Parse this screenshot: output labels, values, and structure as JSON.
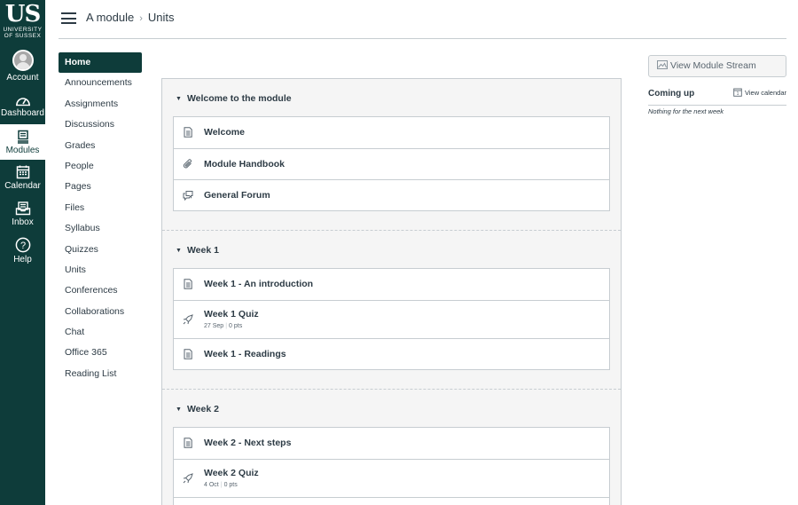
{
  "global_nav": {
    "logo_main": "US",
    "logo_line1": "UNIVERSITY",
    "logo_line2": "OF SUSSEX",
    "items": [
      {
        "label": "Account",
        "icon": "avatar-icon"
      },
      {
        "label": "Dashboard",
        "icon": "dashboard-icon"
      },
      {
        "label": "Modules",
        "icon": "modules-icon",
        "active": true
      },
      {
        "label": "Calendar",
        "icon": "calendar-icon"
      },
      {
        "label": "Inbox",
        "icon": "inbox-icon"
      },
      {
        "label": "Help",
        "icon": "help-icon"
      }
    ],
    "colors": {
      "background": "#0e3c3a",
      "text": "#ffffff"
    }
  },
  "header": {
    "breadcrumb": [
      "A module",
      "Units"
    ],
    "breadcrumb_separator": "›"
  },
  "course_nav": {
    "items": [
      "Home",
      "Announcements",
      "Assignments",
      "Discussions",
      "Grades",
      "People",
      "Pages",
      "Files",
      "Syllabus",
      "Quizzes",
      "Units",
      "Conferences",
      "Collaborations",
      "Chat",
      "Office 365",
      "Reading List"
    ],
    "active": "Home"
  },
  "modules": [
    {
      "title": "Welcome to the module",
      "items": [
        {
          "title": "Welcome",
          "icon": "page-icon"
        },
        {
          "title": "Module Handbook",
          "icon": "attachment-icon"
        },
        {
          "title": "General Forum",
          "icon": "discussion-icon"
        }
      ]
    },
    {
      "title": "Week 1",
      "items": [
        {
          "title": "Week 1 - An introduction",
          "icon": "page-icon"
        },
        {
          "title": "Week 1 Quiz",
          "icon": "quiz-icon",
          "date": "27 Sep",
          "points": "0 pts"
        },
        {
          "title": "Week 1 - Readings",
          "icon": "page-icon"
        }
      ]
    },
    {
      "title": "Week 2",
      "items": [
        {
          "title": "Week 2 - Next steps",
          "icon": "page-icon"
        },
        {
          "title": "Week 2 Quiz",
          "icon": "quiz-icon",
          "date": "4 Oct",
          "points": "0 pts"
        }
      ]
    }
  ],
  "sidebar": {
    "stream_button": "View Module Stream",
    "coming_up": "Coming up",
    "view_calendar": "View calendar",
    "nothing": "Nothing for the next week"
  }
}
